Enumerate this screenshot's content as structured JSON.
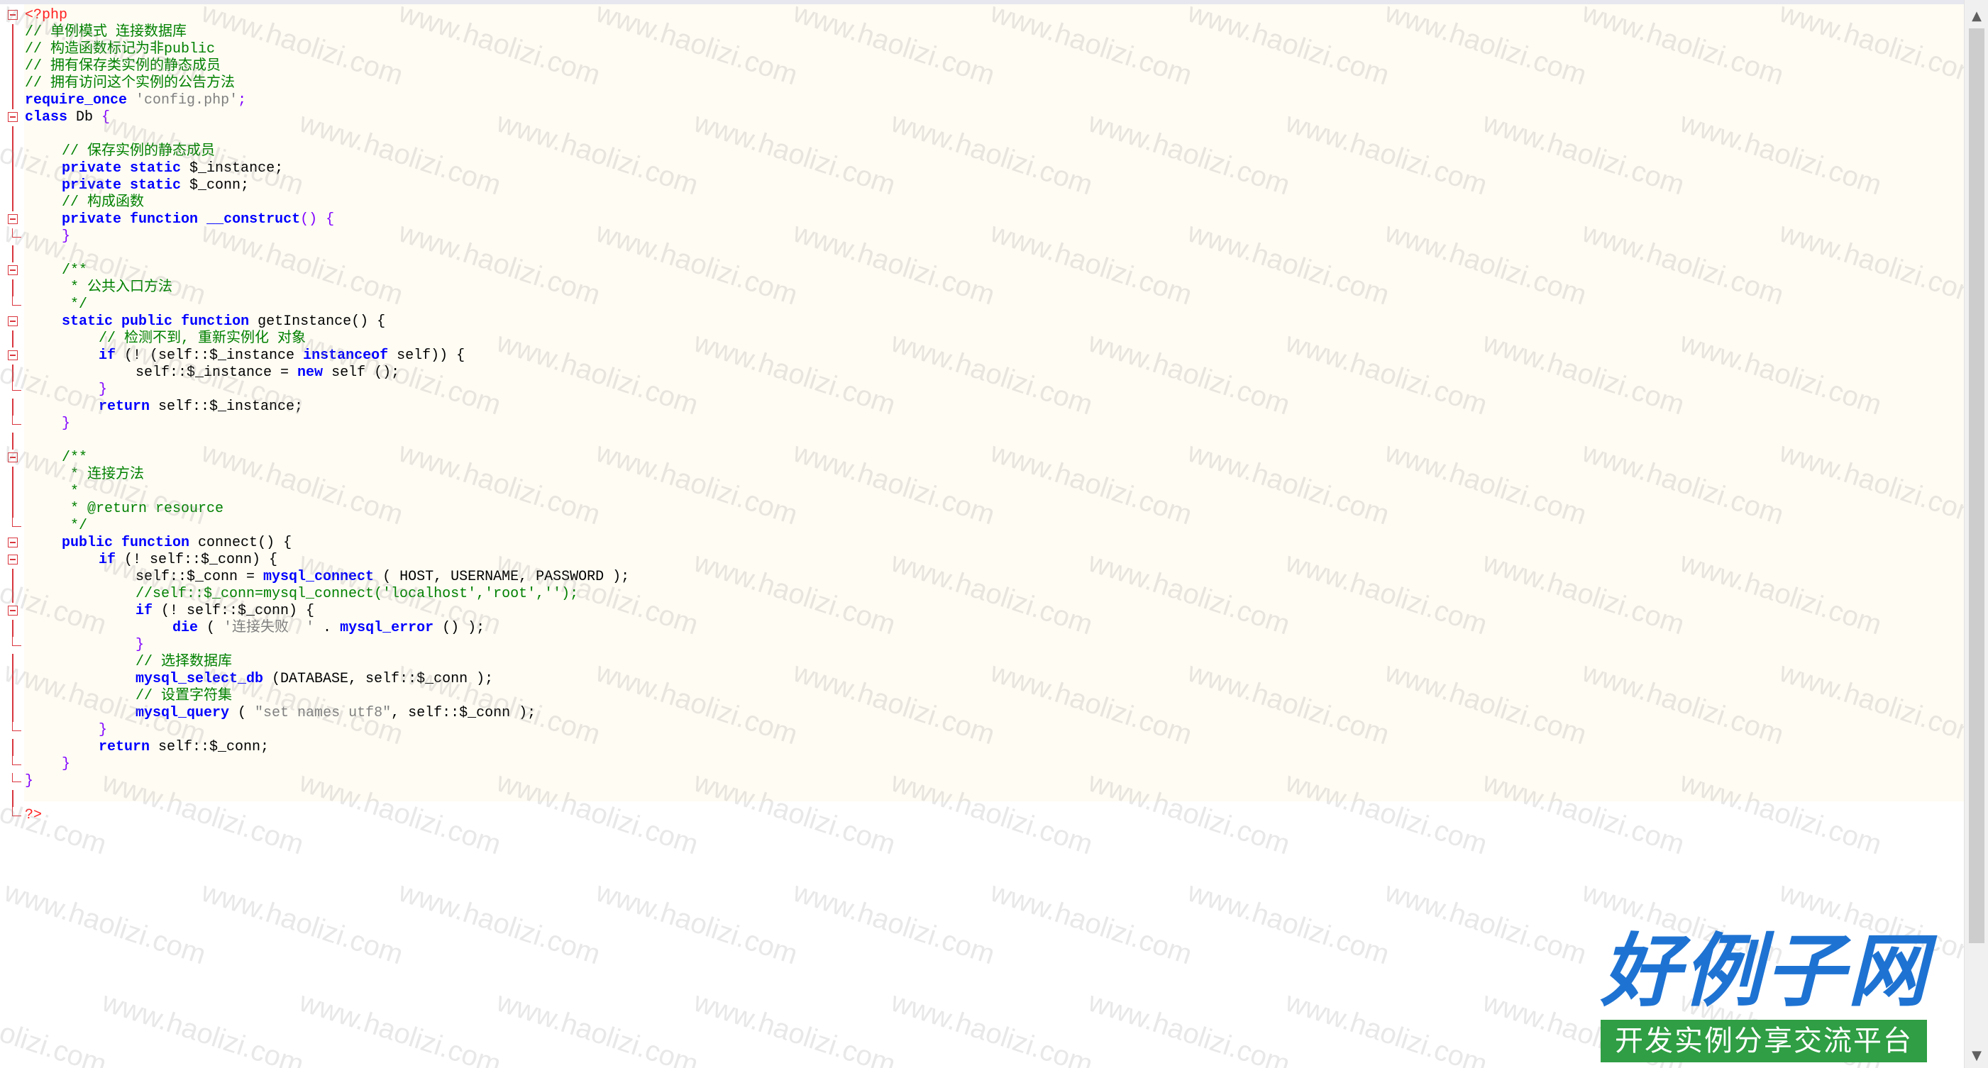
{
  "editor": {
    "lines": [
      [
        "<?php"
      ],
      [
        "// 单例模式 连接数据库"
      ],
      [
        "// 构造函数标记为非public"
      ],
      [
        "// 拥有保存类实例的静态成员"
      ],
      [
        "// 拥有访问这个实例的公告方法"
      ],
      [
        "require_once",
        " ",
        "'config.php'",
        ";"
      ],
      [
        "class",
        " Db ",
        "{"
      ],
      [
        ""
      ],
      [
        "// 保存实例的静态成员"
      ],
      [
        "private",
        " ",
        "static",
        " $_instance;"
      ],
      [
        "private",
        " ",
        "static",
        " $_conn;"
      ],
      [
        "// 构成函数"
      ],
      [
        "private",
        " ",
        "function",
        " ",
        "__construct",
        "() {"
      ],
      [
        "}"
      ],
      [
        ""
      ],
      [
        "/**"
      ],
      [
        " * 公共入口方法"
      ],
      [
        " */"
      ],
      [
        "static",
        " ",
        "public",
        " ",
        "function",
        " getInstance() {"
      ],
      [
        "// 检测不到, 重新实例化 对象"
      ],
      [
        "if",
        " (! (self::$_instance ",
        "instanceof",
        " self)) {"
      ],
      [
        "self::$_instance = ",
        "new",
        " self ();"
      ],
      [
        "}"
      ],
      [
        "return",
        " self::$_instance;"
      ],
      [
        "}"
      ],
      [
        ""
      ],
      [
        "/**"
      ],
      [
        " * 连接方法"
      ],
      [
        " *"
      ],
      [
        " * @return resource"
      ],
      [
        " */"
      ],
      [
        "public",
        " ",
        "function",
        " connect() {"
      ],
      [
        "if",
        " (! self::$_conn) {"
      ],
      [
        "self::$_conn = ",
        "mysql_connect",
        " ( HOST, USERNAME, PASSWORD );"
      ],
      [
        "//self::$_conn=mysql_connect('localhost','root','');"
      ],
      [
        "if",
        " (! self::$_conn) {"
      ],
      [
        "die",
        " ( ",
        "'连接失败  '",
        " . ",
        "mysql_error",
        " () );"
      ],
      [
        "}"
      ],
      [
        "// 选择数据库"
      ],
      [
        "mysql_select_db",
        " (DATABASE, self::$_conn );"
      ],
      [
        "// 设置字符集"
      ],
      [
        "mysql_query",
        " ( ",
        "\"set names utf8\"",
        ", self::$_conn );"
      ],
      [
        "}"
      ],
      [
        "return",
        " self::$_conn;"
      ],
      [
        "}"
      ],
      [
        "}"
      ],
      [
        ""
      ],
      [
        "?>"
      ]
    ]
  },
  "watermark_text": "www.haolizi.com",
  "logo": {
    "main": "好例子网",
    "sub": "开发实例分享交流平台"
  },
  "scrollbar": {
    "up_icon": "▲",
    "down_icon": "▼"
  }
}
